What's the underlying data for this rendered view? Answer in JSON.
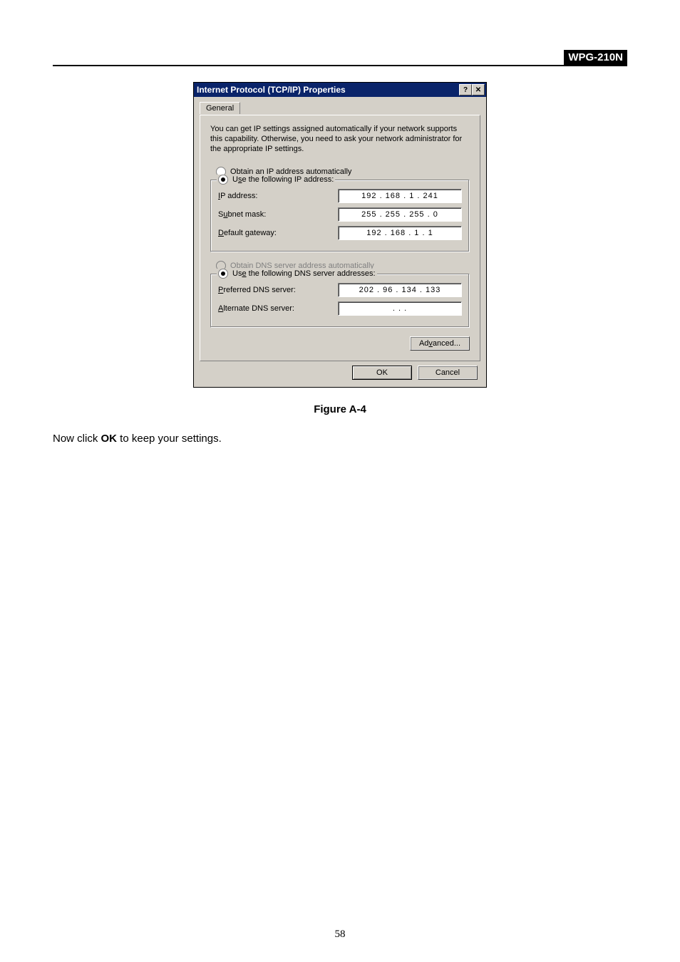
{
  "header": {
    "model": "WPG-210N"
  },
  "dialog": {
    "title": "Internet Protocol (TCP/IP) Properties",
    "help_glyph": "?",
    "close_glyph": "✕",
    "tab_label": "General",
    "description": "You can get IP settings assigned automatically if your network supports this capability. Otherwise, you need to ask your network administrator for the appropriate IP settings.",
    "ip": {
      "auto_label": "Obtain an IP address automatically",
      "manual_label": "Use the following IP address:",
      "rows": {
        "ip": {
          "label": "IP address:",
          "value": "192 . 168 .  1  . 241"
        },
        "subnet": {
          "label": "Subnet mask:",
          "value": "255 . 255 . 255 .  0"
        },
        "gateway": {
          "label": "Default gateway:",
          "value": "192 . 168 .  1  .  1"
        }
      }
    },
    "dns": {
      "auto_label": "Obtain DNS server address automatically",
      "manual_label": "Use the following DNS server addresses:",
      "rows": {
        "preferred": {
          "label": "Preferred DNS server:",
          "value": "202 . 96  . 134 . 133"
        },
        "alternate": {
          "label": "Alternate DNS server:",
          "value": " .       .       ."
        }
      }
    },
    "advanced_label": "Advanced...",
    "ok_label": "OK",
    "cancel_label": "Cancel"
  },
  "caption": "Figure A-4",
  "body": {
    "pre": "Now click ",
    "bold": "OK",
    "post": " to keep your settings."
  },
  "page_number": "58",
  "underlines": {
    "obtain_ip": "O",
    "use_ip": "s",
    "ip": "I",
    "subnet": "u",
    "gateway": "D",
    "obtain_dns": "b",
    "use_dns": "e",
    "preferred": "P",
    "alternate": "A",
    "advanced": "v"
  }
}
